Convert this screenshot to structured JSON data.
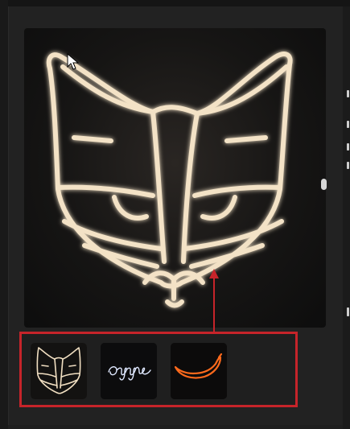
{
  "gallery": {
    "main_image": {
      "icon": "neon-cat-face-icon",
      "neon_color": "#f3e2c6"
    },
    "thumbnails": [
      {
        "icon": "neon-cat-thumbnail-icon",
        "selected": true
      },
      {
        "icon": "neon-signature-thumbnail-icon",
        "selected": false
      },
      {
        "icon": "neon-banana-thumbnail-icon",
        "selected": false
      }
    ],
    "highlight_color": "#c6242a"
  }
}
